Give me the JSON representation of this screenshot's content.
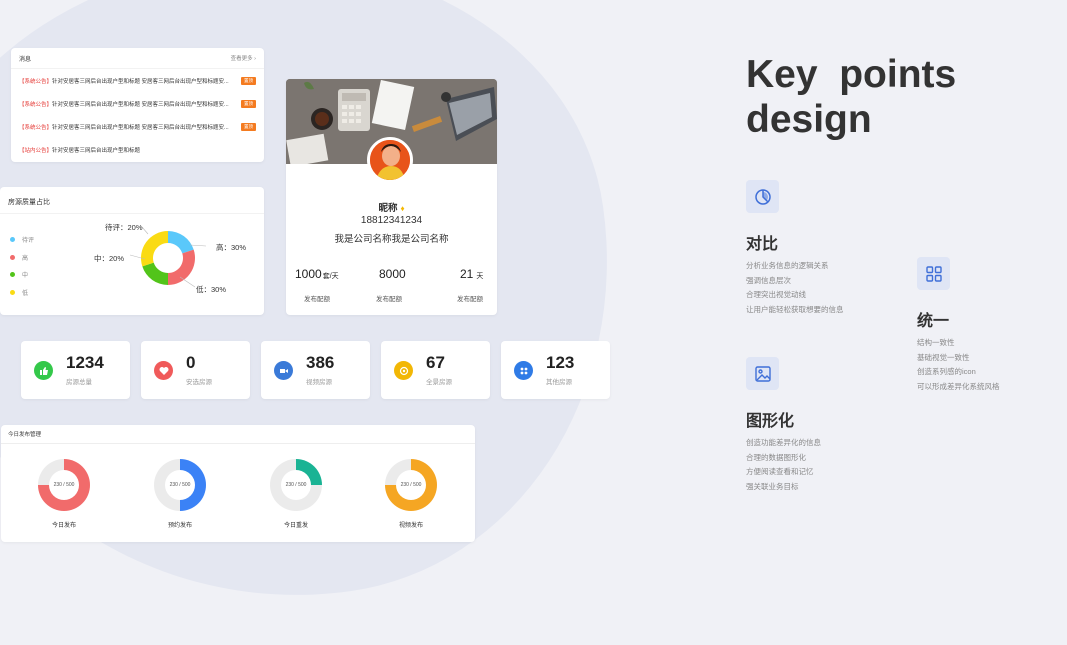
{
  "notice": {
    "title": "消息",
    "more": "查看更多",
    "items": [
      {
        "tag": "【系统公告】",
        "text": "针对安居客三网后台出现户型和标题 安居客三网后台出现户型和标题安...",
        "badge": "置顶"
      },
      {
        "tag": "【系统公告】",
        "text": "针对安居客三网后台出现户型和标题 安居客三网后台出现户型和标题安...",
        "badge": "置顶"
      },
      {
        "tag": "【系统公告】",
        "text": "针对安居客三网后台出现户型和标题 安居客三网后台出现户型和标题安...",
        "badge": "置顶"
      },
      {
        "tag": "【站内公告】",
        "text": "针对安居客三网后台出现户型和标题",
        "badge": ""
      }
    ]
  },
  "quality": {
    "title": "房源质量占比",
    "legend": [
      "待评",
      "高",
      "中",
      "低"
    ],
    "labels": {
      "pending": "待评：20%",
      "high": "高：30%",
      "mid": "中：20%",
      "low": "低：30%"
    },
    "chart_data": {
      "type": "pie",
      "categories": [
        "待评",
        "高",
        "中",
        "低"
      ],
      "values": [
        20,
        30,
        20,
        30
      ],
      "colors": [
        "#5ac8fa",
        "#f16b6b",
        "#52c41a",
        "#fadb14"
      ]
    }
  },
  "profile": {
    "name": "昵称",
    "phone": "18812341234",
    "company": "我是公司名称我是公司名称",
    "stats": [
      {
        "value": "1000",
        "unit": "套/天",
        "label": "发布配额"
      },
      {
        "value": "8000",
        "unit": "",
        "label": "发布配额"
      },
      {
        "value": "21",
        "unit": "天",
        "label": "发布配额"
      }
    ]
  },
  "stats": [
    {
      "value": "1234",
      "label": "房源总量",
      "color": "#34c84a",
      "icon": "thumbs-up-icon"
    },
    {
      "value": "0",
      "label": "安选房源",
      "color": "#f05a5a",
      "icon": "heart-icon"
    },
    {
      "value": "386",
      "label": "视频房源",
      "color": "#3a7ad8",
      "icon": "video-icon"
    },
    {
      "value": "67",
      "label": "全景房源",
      "color": "#f2b705",
      "icon": "panorama-icon"
    },
    {
      "value": "123",
      "label": "其他房源",
      "color": "#2f7be6",
      "icon": "grid-icon"
    }
  ],
  "today": {
    "title": "今日发布管理",
    "rings": [
      {
        "text": "230 / 500",
        "label": "今日发布",
        "color": "#f16b6b",
        "percent": 75
      },
      {
        "text": "230 / 500",
        "label": "预约发布",
        "color": "#3b82f6",
        "percent": 50
      },
      {
        "text": "230 / 500",
        "label": "今日重发",
        "color": "#1ab394",
        "percent": 25
      },
      {
        "text": "230 / 500",
        "label": "视频发布",
        "color": "#f5a623",
        "percent": 75
      }
    ]
  },
  "design": {
    "title_line1": "Key  points",
    "title_line2": "design",
    "features": [
      {
        "icon": "pie-chart-icon",
        "heading": "对比",
        "lines": [
          "分析业务信息的逻辑关系",
          "强调信息层次",
          "合理突出视觉动线",
          "让用户能轻松获取想要的信息"
        ]
      },
      {
        "icon": "grid-icon",
        "heading": "统一",
        "lines": [
          "结构一致性",
          "基础视觉一致性",
          "创造系列感的icon",
          "可以形成差异化系统风格"
        ]
      },
      {
        "icon": "image-icon",
        "heading": "图形化",
        "lines": [
          "创造功能差异化的信息",
          "合理的数据图形化",
          "方便阅读查看和记忆",
          "强关联业务目标"
        ]
      }
    ]
  }
}
